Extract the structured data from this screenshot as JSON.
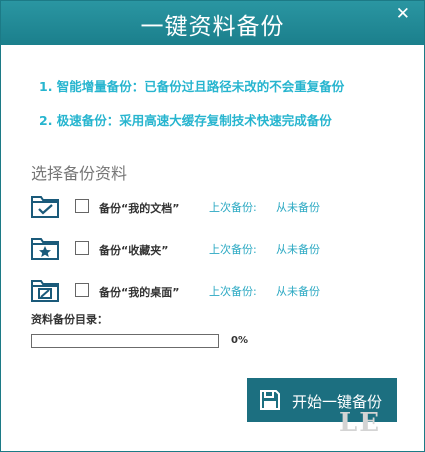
{
  "window": {
    "title": "一键资料备份",
    "close_symbol": "✕"
  },
  "tips": [
    "1. 智能增量备份：已备份过且路径未改的不会重复备份",
    "2. 极速备份：采用高速大缓存复制技术快速完成备份"
  ],
  "section_title": "选择备份资料",
  "items": [
    {
      "icon": "folder-check-icon",
      "label": "备份“我的文档”",
      "last_backup_label": "上次备份:",
      "last_backup_value": "从未备份",
      "checked": false
    },
    {
      "icon": "folder-star-icon",
      "label": "备份“收藏夹”",
      "last_backup_label": "上次备份:",
      "last_backup_value": "从未备份",
      "checked": false
    },
    {
      "icon": "folder-desktop-icon",
      "label": "备份“我的桌面”",
      "last_backup_label": "上次备份:",
      "last_backup_value": "从未备份",
      "checked": false
    }
  ],
  "directory_label": "资料备份目录：",
  "progress": {
    "value": 0,
    "text": "0%"
  },
  "start_button": {
    "label": "开始一键备份",
    "icon": "save-disk-icon"
  },
  "watermark": "LE",
  "colors": {
    "title_bar": "#1b7f8c",
    "accent_text": "#27b5cf",
    "button": "#1c6f80"
  }
}
